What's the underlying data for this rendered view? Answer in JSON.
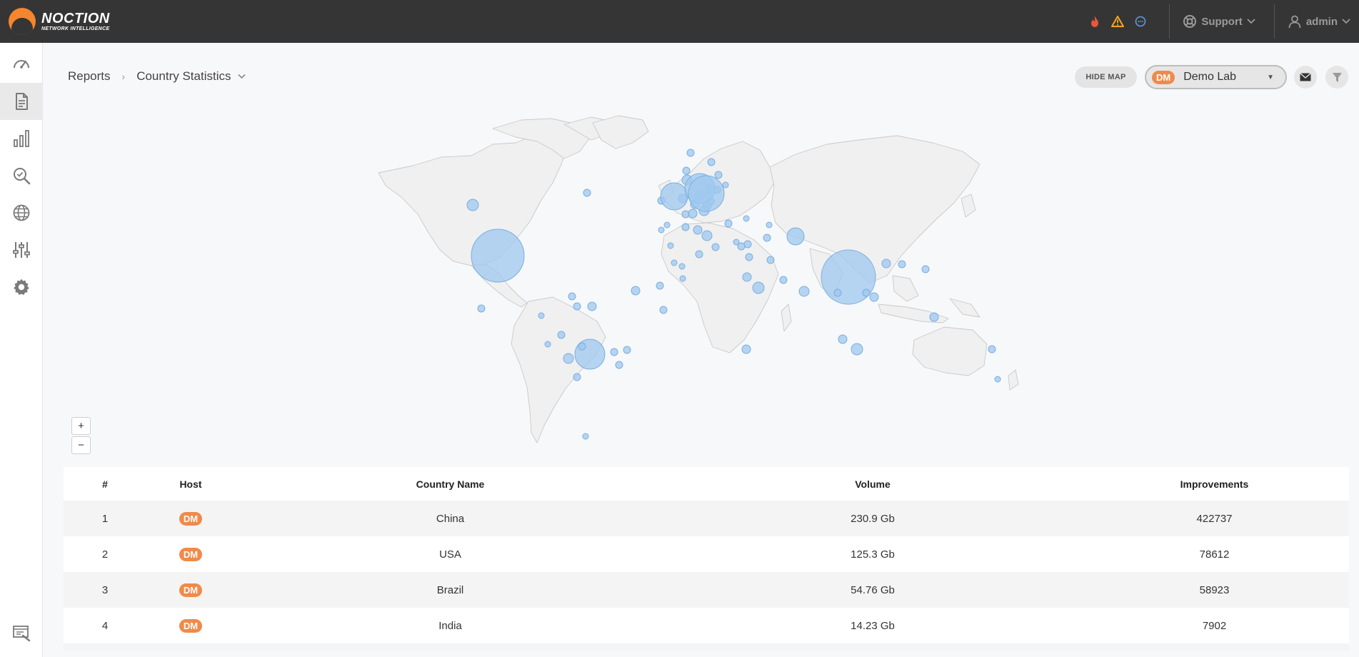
{
  "brand": {
    "name": "NOCTION",
    "tagline": "NETWORK INTELLIGENCE"
  },
  "topbar": {
    "alerts": [
      {
        "icon": "fire-icon",
        "color": "#e8573a"
      },
      {
        "icon": "warning-icon",
        "color": "#f5a623"
      },
      {
        "icon": "chat-icon",
        "color": "#5b8ed6"
      }
    ],
    "support_label": "Support",
    "user_label": "admin"
  },
  "sidebar": {
    "items": [
      {
        "icon": "dashboard-icon",
        "active": false
      },
      {
        "icon": "reports-icon",
        "active": true
      },
      {
        "icon": "bar-chart-icon",
        "active": false
      },
      {
        "icon": "search-check-icon",
        "active": false
      },
      {
        "icon": "globe-icon",
        "active": false
      },
      {
        "icon": "sliders-icon",
        "active": false
      },
      {
        "icon": "gear-icon",
        "active": false
      }
    ],
    "bottom_icon": "console-icon"
  },
  "breadcrumb": {
    "root": "Reports",
    "current": "Country Statistics"
  },
  "toolbar": {
    "hide_map_label": "HIDE MAP",
    "host_badge": "DM",
    "host_name": "Demo Lab",
    "mail_icon": "mail-icon",
    "filter_icon": "filter-icon"
  },
  "map": {
    "zoom_in_label": "+",
    "zoom_out_label": "−",
    "bubble_color": "#9fc8ef"
  },
  "table": {
    "headers": {
      "num": "#",
      "host": "Host",
      "country": "Country Name",
      "volume": "Volume",
      "improvements": "Improvements"
    },
    "rows": [
      {
        "num": "1",
        "host": "DM",
        "country": "China",
        "volume": "230.9 Gb",
        "improvements": "422737"
      },
      {
        "num": "2",
        "host": "DM",
        "country": "USA",
        "volume": "125.3 Gb",
        "improvements": "78612"
      },
      {
        "num": "3",
        "host": "DM",
        "country": "Brazil",
        "volume": "54.76 Gb",
        "improvements": "58923"
      },
      {
        "num": "4",
        "host": "DM",
        "country": "India",
        "volume": "14.23 Gb",
        "improvements": "7902"
      }
    ]
  }
}
